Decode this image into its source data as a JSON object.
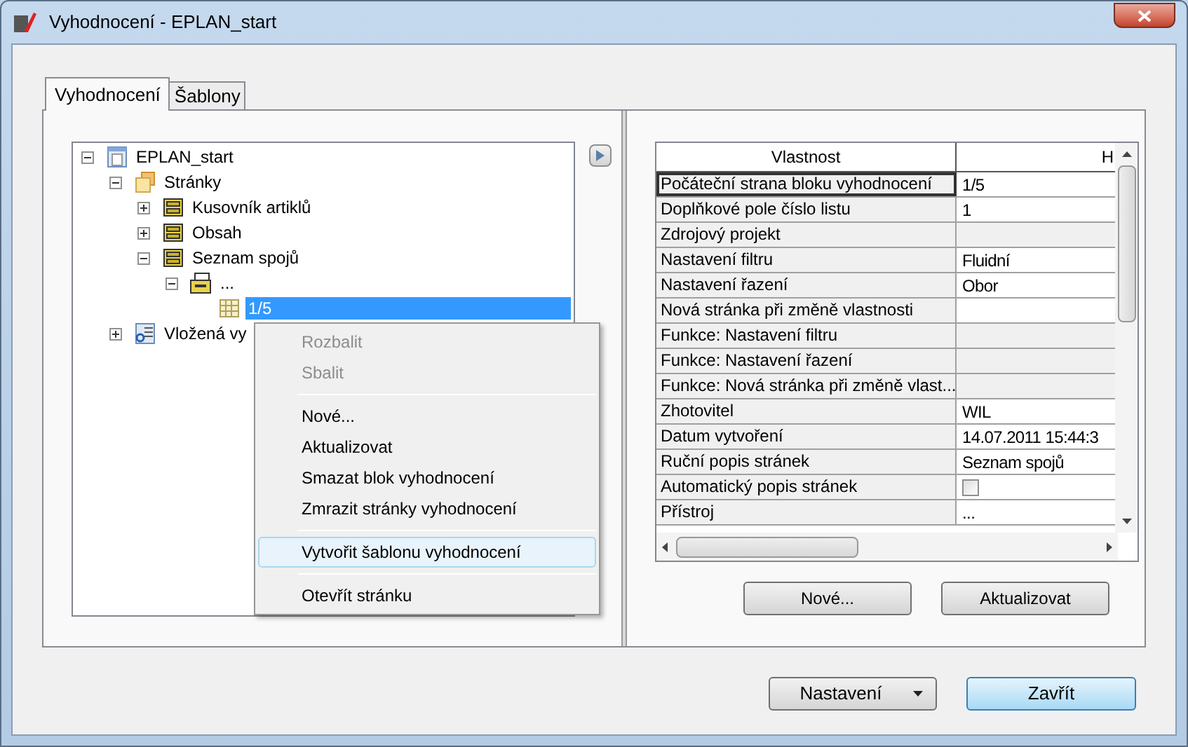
{
  "window": {
    "title": "Vyhodnocení - EPLAN_start"
  },
  "tabs": [
    {
      "label": "Vyhodnocení",
      "selected": true
    },
    {
      "label": "Šablony",
      "selected": false
    }
  ],
  "tree": [
    {
      "label": "EPLAN_start",
      "kind": "project",
      "expanded": true,
      "selected": false,
      "children": [
        {
          "label": "Stránky",
          "kind": "pages",
          "expanded": true,
          "selected": false,
          "children": [
            {
              "label": "Kusovník artiklů",
              "kind": "block",
              "expanded": false,
              "selected": false
            },
            {
              "label": "Obsah",
              "kind": "block",
              "expanded": false,
              "selected": false
            },
            {
              "label": "Seznam spojů",
              "kind": "block",
              "expanded": true,
              "selected": false,
              "children": [
                {
                  "label": "...",
                  "kind": "subblock",
                  "expanded": true,
                  "selected": false,
                  "children": [
                    {
                      "label": "1/5",
                      "kind": "page",
                      "selected": true
                    }
                  ]
                }
              ]
            }
          ]
        },
        {
          "label": "Vložená vy",
          "kind": "embedded",
          "expanded": false,
          "selected": false
        }
      ]
    }
  ],
  "context_menu": [
    {
      "label": "Rozbalit",
      "disabled": true,
      "selected": false
    },
    {
      "label": "Sbalit",
      "disabled": true,
      "selected": false
    },
    {
      "kind": "separator"
    },
    {
      "label": "Nové...",
      "disabled": false,
      "selected": false
    },
    {
      "label": "Aktualizovat",
      "disabled": false,
      "selected": false
    },
    {
      "label": "Smazat blok vyhodnocení",
      "disabled": false,
      "selected": false
    },
    {
      "label": "Zmrazit stránky vyhodnocení",
      "disabled": false,
      "selected": false
    },
    {
      "kind": "separator"
    },
    {
      "label": "Vytvořit šablonu vyhodnocení",
      "disabled": false,
      "selected": true
    },
    {
      "kind": "separator"
    },
    {
      "label": "Otevřít stránku",
      "disabled": false,
      "selected": false
    }
  ],
  "property_grid": {
    "columns": [
      "Vlastnost",
      "H"
    ],
    "rows": [
      {
        "name": "Počáteční strana bloku vyhodnocení",
        "value": "1/5",
        "kind": "text",
        "selected": true
      },
      {
        "name": "Doplňkové pole číslo listu",
        "value": "1",
        "kind": "text",
        "selected": false
      },
      {
        "name": "Zdrojový projekt",
        "value": "",
        "kind": "readonly",
        "selected": false
      },
      {
        "name": "Nastavení filtru",
        "value": "Fluidní",
        "kind": "text",
        "selected": false
      },
      {
        "name": "Nastavení řazení",
        "value": "Obor",
        "kind": "text",
        "selected": false
      },
      {
        "name": "Nová stránka při změně vlastnosti",
        "value": "",
        "kind": "text",
        "selected": false
      },
      {
        "name": "Funkce: Nastavení filtru",
        "value": "",
        "kind": "readonly",
        "selected": false
      },
      {
        "name": "Funkce: Nastavení řazení",
        "value": "",
        "kind": "readonly",
        "selected": false
      },
      {
        "name": "Funkce: Nová stránka při změně vlast...",
        "value": "",
        "kind": "readonly",
        "selected": false
      },
      {
        "name": "Zhotovitel",
        "value": "WIL",
        "kind": "text",
        "selected": false
      },
      {
        "name": "Datum vytvoření",
        "value": "14.07.2011 15:44:3",
        "kind": "text",
        "selected": false
      },
      {
        "name": "Ruční popis stránek",
        "value": "Seznam spojů",
        "kind": "text",
        "selected": false
      },
      {
        "name": "Automatický popis stránek",
        "kind": "checkbox",
        "checked": false,
        "selected": false
      },
      {
        "name": "Přístroj",
        "value": "...",
        "kind": "text",
        "selected": false
      }
    ]
  },
  "grid_buttons": [
    "Nové...",
    "Aktualizovat"
  ],
  "footer": {
    "settings_button": "Nastavení",
    "close_button": "Zavřít"
  }
}
